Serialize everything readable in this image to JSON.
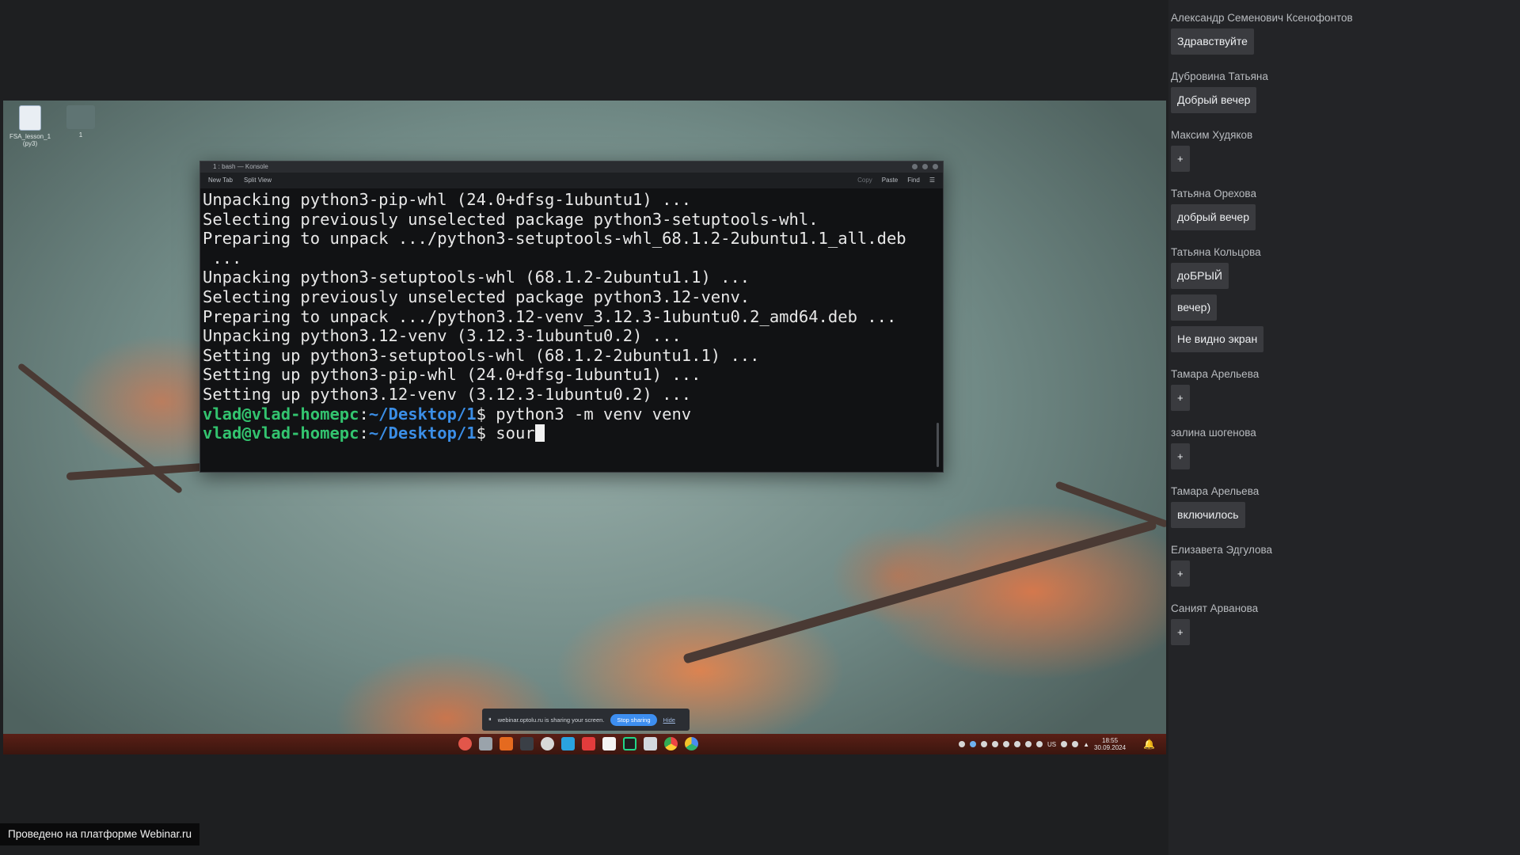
{
  "desktop": {
    "icons": [
      {
        "label": "FSA_lesson_1 (py3)",
        "icon": "document-icon"
      },
      {
        "label": "1",
        "icon": "folder-icon"
      }
    ]
  },
  "konsole": {
    "title": "1 : bash — Konsole",
    "toolbar": {
      "new_tab": "New Tab",
      "split_view": "Split View",
      "copy": "Copy",
      "paste": "Paste",
      "find": "Find"
    },
    "lines": [
      "Unpacking python3-pip-whl (24.0+dfsg-1ubuntu1) ...",
      "Selecting previously unselected package python3-setuptools-whl.",
      "Preparing to unpack .../python3-setuptools-whl_68.1.2-2ubuntu1.1_all.deb",
      " ...",
      "Unpacking python3-setuptools-whl (68.1.2-2ubuntu1.1) ...",
      "Selecting previously unselected package python3.12-venv.",
      "Preparing to unpack .../python3.12-venv_3.12.3-1ubuntu0.2_amd64.deb ...",
      "Unpacking python3.12-venv (3.12.3-1ubuntu0.2) ...",
      "Setting up python3-setuptools-whl (68.1.2-2ubuntu1.1) ...",
      "Setting up python3-pip-whl (24.0+dfsg-1ubuntu1) ...",
      "Setting up python3.12-venv (3.12.3-1ubuntu0.2) ..."
    ],
    "prompt_user": "vlad@vlad-homepc",
    "prompt_sep": ":",
    "prompt_path": "~/Desktop/1",
    "prompt_symbol": "$ ",
    "command_1": "python3 -m venv venv",
    "command_2": "sour"
  },
  "share_banner": {
    "text": "webinar.optolu.ru is sharing your screen.",
    "stop_label": "Stop sharing",
    "hide_label": "Hide"
  },
  "taskbar": {
    "apps": [
      "vivaldi-icon",
      "files-icon",
      "ardour-icon",
      "terminal-icon",
      "obs-icon",
      "telegram-icon",
      "xmind-icon",
      "yandex-icon",
      "pycharm-icon",
      "mail-icon",
      "chrome-icon",
      "chromium-icon"
    ],
    "tray_lang": "US",
    "time": "18:55",
    "date": "30.09.2024"
  },
  "chat": {
    "messages": [
      {
        "author": "Александр Семенович Ксенофонтов",
        "bubbles": [
          "Здравствуйте"
        ]
      },
      {
        "author": "Дубровина Татьяна",
        "bubbles": [
          "Добрый вечер"
        ]
      },
      {
        "author": "Максим Худяков",
        "bubbles": [
          "+"
        ]
      },
      {
        "author": "Татьяна Орехова",
        "bubbles": [
          "добрый вечер"
        ]
      },
      {
        "author": "Татьяна Кольцова",
        "bubbles": [
          "доБРЫЙ",
          "вечер)",
          "Не видно экран"
        ]
      },
      {
        "author": "Тамара Арельева",
        "bubbles": [
          "+"
        ]
      },
      {
        "author": "залина шогенова",
        "bubbles": [
          "+"
        ]
      },
      {
        "author": "Тамара Арельева",
        "bubbles": [
          "включилось"
        ]
      },
      {
        "author": "Елизавета Эдгулова",
        "bubbles": [
          "+"
        ]
      },
      {
        "author": "Саният Арванова",
        "bubbles": [
          "+"
        ]
      }
    ]
  },
  "footer": {
    "label": "Проведено на платформе Webinar.ru"
  }
}
